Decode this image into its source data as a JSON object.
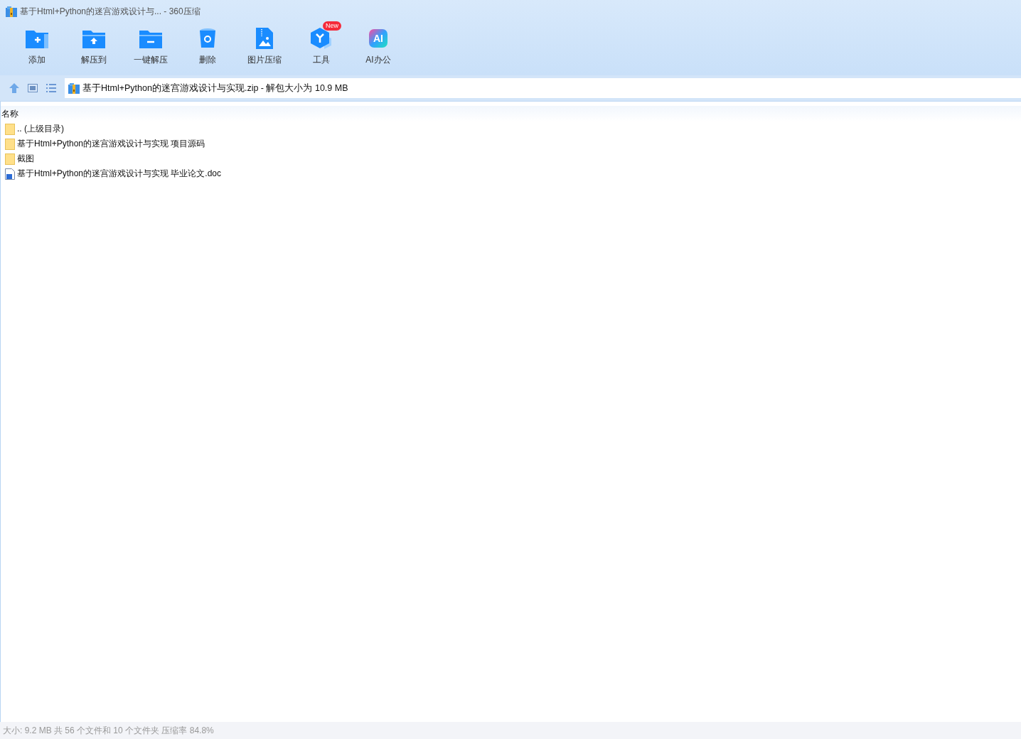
{
  "window": {
    "title": "基于Html+Python的迷宫游戏设计与... - 360压缩"
  },
  "toolbar": [
    {
      "kind": "add",
      "label": "添加"
    },
    {
      "kind": "extract",
      "label": "解压到"
    },
    {
      "kind": "oneclick",
      "label": "一键解压"
    },
    {
      "kind": "delete",
      "label": "删除"
    },
    {
      "kind": "image",
      "label": "图片压缩"
    },
    {
      "kind": "tools",
      "label": "工具",
      "badge": "New"
    },
    {
      "kind": "ai",
      "label": "AI办公",
      "icon_text": "AI"
    }
  ],
  "address": {
    "path": "基于Html+Python的迷宫游戏设计与实现.zip - 解包大小为 10.9 MB"
  },
  "list": {
    "columns": [
      "名称"
    ],
    "rows": [
      {
        "kind": "folder",
        "name": ".. (上级目录)"
      },
      {
        "kind": "folder",
        "name": "基于Html+Python的迷宫游戏设计与实现 项目源码"
      },
      {
        "kind": "folder",
        "name": "截图"
      },
      {
        "kind": "doc",
        "name": "基于Html+Python的迷宫游戏设计与实现 毕业论文.doc"
      }
    ]
  },
  "status_bar": "大小: 9.2 MB 共 56 个文件和 10 个文件夹 压缩率 84.8%"
}
